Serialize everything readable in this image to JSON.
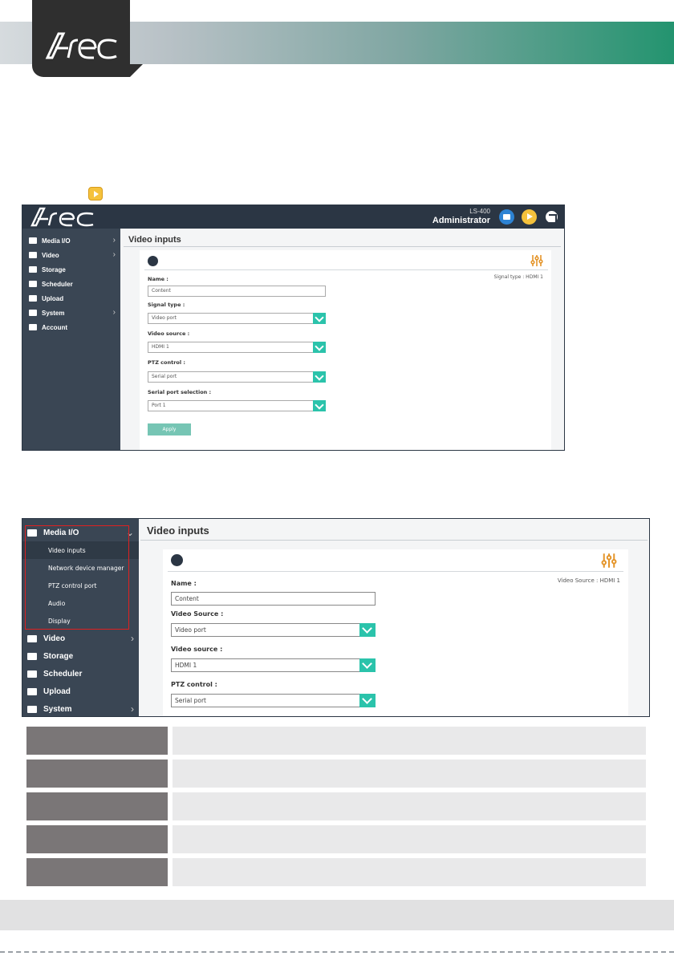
{
  "header": {
    "logo_text": "Arec"
  },
  "shot1": {
    "brand": "Arec",
    "model": "LS-400",
    "user": "Administrator",
    "nav": [
      {
        "label": "Media I/O",
        "icon": "media-io-icon",
        "chevron": "›"
      },
      {
        "label": "Video",
        "icon": "video-icon",
        "chevron": "›"
      },
      {
        "label": "Storage",
        "icon": "storage-icon",
        "chevron": ""
      },
      {
        "label": "Scheduler",
        "icon": "calendar-icon",
        "chevron": ""
      },
      {
        "label": "Upload",
        "icon": "upload-icon",
        "chevron": ""
      },
      {
        "label": "System",
        "icon": "tools-icon",
        "chevron": "›"
      },
      {
        "label": "Account",
        "icon": "user-icon",
        "chevron": ""
      }
    ],
    "title": "Video inputs",
    "signal_info": "Signal type :  HDMI 1",
    "fields": {
      "name_label": "Name :",
      "name_value": "Content",
      "signal_type_label": "Signal type :",
      "signal_type_value": "Video port",
      "video_source_label": "Video source :",
      "video_source_value": "HDMI 1",
      "ptz_label": "PTZ control :",
      "ptz_value": "Serial port",
      "serial_label": "Serial port selection :",
      "serial_value": "Port 1"
    },
    "apply_label": "Apply"
  },
  "shot2": {
    "nav_top": {
      "label": "Media I/O",
      "chevron": "⌄"
    },
    "subnav": [
      "Video inputs",
      "Network device manager",
      "PTZ control port",
      "Audio",
      "Display"
    ],
    "nav_rest": [
      {
        "label": "Video",
        "chevron": "›"
      },
      {
        "label": "Storage",
        "chevron": ""
      },
      {
        "label": "Scheduler",
        "chevron": ""
      },
      {
        "label": "Upload",
        "chevron": ""
      },
      {
        "label": "System",
        "chevron": "›"
      }
    ],
    "title": "Video inputs",
    "signal_info": "Video Source :  HDMI 1",
    "fields": {
      "name_label": "Name :",
      "name_value": "Content",
      "video_source_label_1": "Video Source :",
      "video_source_value_1": "Video port",
      "video_source_label_2": "Video source :",
      "video_source_value_2": "HDMI 1",
      "ptz_label": "PTZ control :",
      "ptz_value": "Serial port"
    }
  },
  "colors": {
    "accent": "#2bc3ab",
    "sidebar": "#3a4654",
    "topbar": "#2b3644"
  }
}
